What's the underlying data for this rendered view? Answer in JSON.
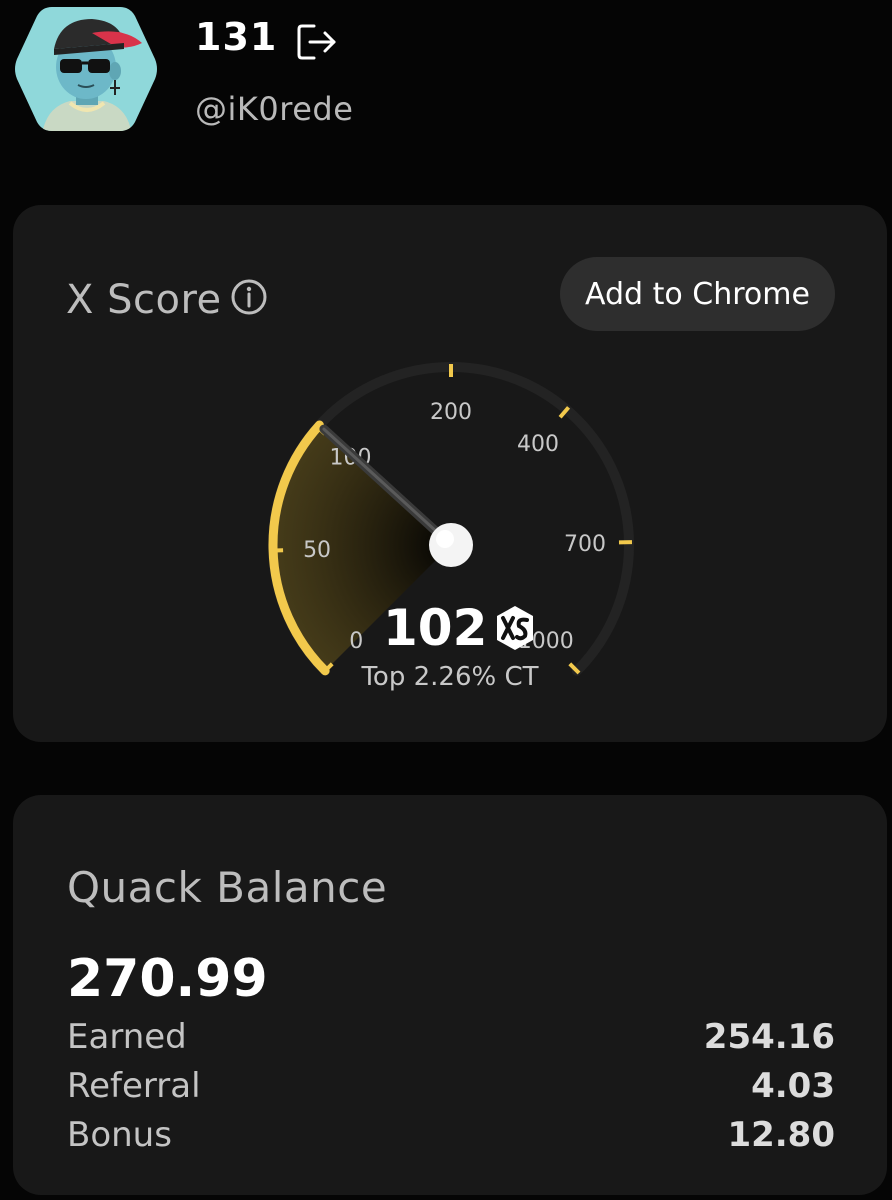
{
  "profile": {
    "name": "131",
    "handle": "@iK0rede",
    "avatar_icon": "cartoon-avatar-cap-sunglasses"
  },
  "xscore": {
    "title": "X Score",
    "button_label": "Add to Chrome",
    "score": "102",
    "rank_text": "Top 2.26% CT",
    "accent_color": "#f2c94c",
    "gauge_ticks": [
      "0",
      "50",
      "100",
      "200",
      "400",
      "700",
      "1000"
    ],
    "gauge_value": 102
  },
  "balance": {
    "title": "Quack Balance",
    "total": "270.99",
    "rows": [
      {
        "label": "Earned",
        "value": "254.16"
      },
      {
        "label": "Referral",
        "value": "4.03"
      },
      {
        "label": "Bonus",
        "value": "12.80"
      }
    ]
  }
}
